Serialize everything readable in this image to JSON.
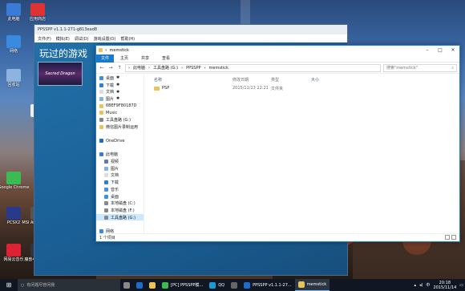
{
  "colors": {
    "accent": "#1979ca",
    "ppsspp_bg": "#1e5c93",
    "taskbar": "#101722",
    "folder": "#e8c35a"
  },
  "desktop_icons": [
    {
      "label": "此电脑",
      "icon": "computer-icon",
      "color": "#3a7bd5"
    },
    {
      "label": "网络",
      "icon": "network-icon",
      "color": "#3a8be0"
    },
    {
      "label": "回收站",
      "icon": "recycle-bin-icon",
      "color": "#8db4e0"
    },
    {
      "label": "应用商店",
      "icon": "app-icon",
      "color": "#d33"
    },
    {
      "label": "Vivo",
      "icon": "app-icon",
      "color": "#eee"
    },
    {
      "label": "Google Chrome",
      "icon": "chrome-icon",
      "color": "#3cba54"
    },
    {
      "label": "PCSX2",
      "icon": "pcsx2-icon",
      "color": "#2a3a8a"
    },
    {
      "label": "MSI Afterburner",
      "icon": "msi-icon",
      "color": "#555"
    },
    {
      "label": "新建文件夹",
      "icon": "folder-icon",
      "color": "#e8c35a"
    },
    {
      "label": "网易云音乐",
      "icon": "music-icon",
      "color": "#d23"
    },
    {
      "label": "魔兽4冰封王座",
      "icon": "game-icon",
      "color": "#334"
    }
  ],
  "ppsspp": {
    "title": "PPSSPP v1.1.1-271-g813ead8",
    "menu": [
      "文件(F)",
      "模拟(E)",
      "调试(D)",
      "游戏设置(O)",
      "帮助(H)"
    ],
    "heading": "玩过的游戏",
    "heading2": "游",
    "game_label": "Sacred Dragon"
  },
  "explorer": {
    "title": "memstick",
    "ribbon": {
      "file": "文件",
      "tabs": [
        "主页",
        "共享",
        "查看"
      ]
    },
    "breadcrumb": [
      "此电脑",
      "工具盘路 (G:)",
      "PPSSPP",
      "memstick"
    ],
    "search_placeholder": "搜索\"memstick\"",
    "nav": [
      {
        "label": "桌面",
        "pinned": true,
        "color": "#3b8fe0"
      },
      {
        "label": "下载",
        "pinned": true,
        "color": "#2f80d1"
      },
      {
        "label": "文档",
        "pinned": true,
        "color": "#ddd"
      },
      {
        "label": "图片",
        "pinned": true,
        "color": "#7fb3e8"
      },
      {
        "label": "6BEF9F80187D",
        "pinned": false,
        "color": "#e8c35a"
      },
      {
        "label": "Music",
        "pinned": false,
        "color": "#e8c35a"
      },
      {
        "label": "工具盘路 (G:)",
        "pinned": false,
        "color": "#888"
      },
      {
        "label": "微信图片录制运用",
        "pinned": false,
        "color": "#e8c35a"
      },
      {
        "label": "",
        "pinned": false,
        "color": ""
      },
      {
        "label": "OneDrive",
        "pinned": false,
        "color": "#1e6ec8"
      },
      {
        "label": "",
        "pinned": false,
        "color": ""
      },
      {
        "label": "此电脑",
        "pinned": false,
        "color": "#3a7bd5"
      },
      {
        "label": "视频",
        "pinned": false,
        "color": "#5a7db0"
      },
      {
        "label": "图片",
        "pinned": false,
        "color": "#7fb3e8"
      },
      {
        "label": "文档",
        "pinned": false,
        "color": "#ddd"
      },
      {
        "label": "下载",
        "pinned": false,
        "color": "#2f80d1"
      },
      {
        "label": "音乐",
        "pinned": false,
        "color": "#4a90d9"
      },
      {
        "label": "桌面",
        "pinned": false,
        "color": "#3b8fe0"
      },
      {
        "label": "本地磁盘 (C:)",
        "pinned": false,
        "color": "#888"
      },
      {
        "label": "本地磁盘 (F:)",
        "pinned": false,
        "color": "#888"
      },
      {
        "label": "工具盘路 (G:)",
        "pinned": false,
        "color": "#888"
      },
      {
        "label": "",
        "pinned": false,
        "color": ""
      },
      {
        "label": "网络",
        "pinned": false,
        "color": "#3a8be0"
      }
    ],
    "nav_selected": 20,
    "columns": [
      "名称",
      "修改日期",
      "类型",
      "大小"
    ],
    "rows": [
      {
        "name": "PSP",
        "date": "2015/11/13 22:21",
        "type": "文件夹",
        "size": ""
      }
    ],
    "status": "1 个项目"
  },
  "taskbar": {
    "start_icon": "windows-icon",
    "search": "有问题尽管问我",
    "buttons": [
      {
        "label": "",
        "icon": "task-view-icon",
        "color": "#888",
        "active": false
      },
      {
        "label": "",
        "icon": "edge-icon",
        "color": "#1e6ec8",
        "active": false
      },
      {
        "label": "",
        "icon": "explorer-icon",
        "color": "#e8c35a",
        "active": false
      },
      {
        "label": "[PC] PPSSPP模...",
        "icon": "chrome-icon",
        "color": "#3cba54",
        "active": false
      },
      {
        "label": "QQ",
        "icon": "qq-icon",
        "color": "#1b9bd6",
        "active": false
      },
      {
        "label": "",
        "icon": "app-icon",
        "color": "#666",
        "active": false
      },
      {
        "label": "PPSSPP v1.1.1-27...",
        "icon": "ppsspp-icon",
        "color": "#1e6ec8",
        "active": false
      },
      {
        "label": "memstick",
        "icon": "folder-icon",
        "color": "#e8c35a",
        "active": true
      }
    ],
    "time": "20:18",
    "date": "2015/11/14",
    "ime": "中"
  }
}
